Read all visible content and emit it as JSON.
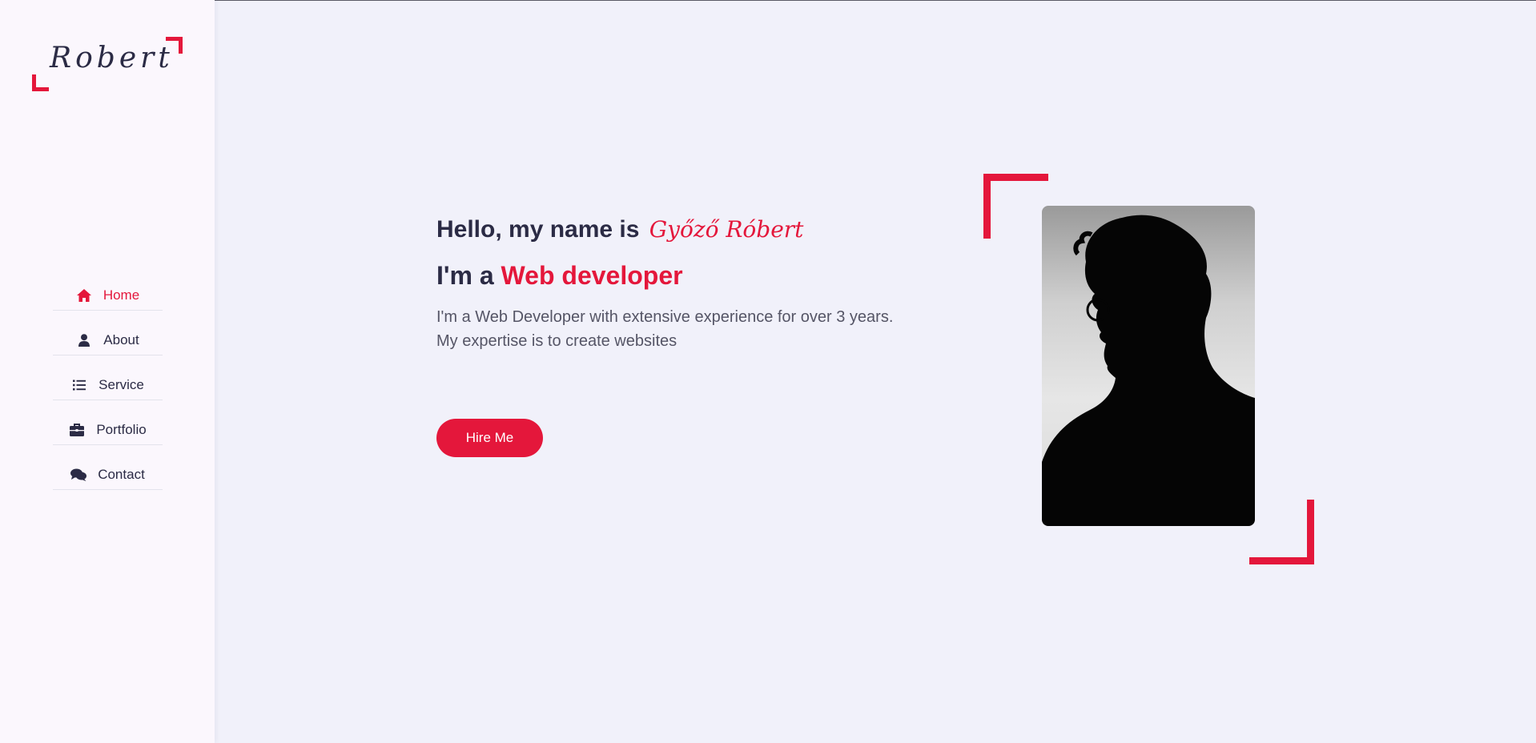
{
  "logo": {
    "text": "Robert"
  },
  "sidebar": {
    "items": [
      {
        "label": "Home",
        "icon": "home-icon",
        "active": true
      },
      {
        "label": "About",
        "icon": "user-icon",
        "active": false
      },
      {
        "label": "Service",
        "icon": "list-icon",
        "active": false
      },
      {
        "label": "Portfolio",
        "icon": "briefcase-icon",
        "active": false
      },
      {
        "label": "Contact",
        "icon": "comments-icon",
        "active": false
      }
    ]
  },
  "hero": {
    "greeting_prefix": "Hello, my name is ",
    "name": "Győző Róbert",
    "role_prefix": "I'm a ",
    "role": "Web developer",
    "description_line1": "I'm a Web Developer with extensive experience for over 3 years.",
    "description_line2": "My expertise is to create websites",
    "cta_label": "Hire Me"
  },
  "colors": {
    "accent": "#e4173b",
    "text_dark": "#2b2b45",
    "background": "#f1f1fa",
    "sidebar_background": "#fbf7fd"
  }
}
